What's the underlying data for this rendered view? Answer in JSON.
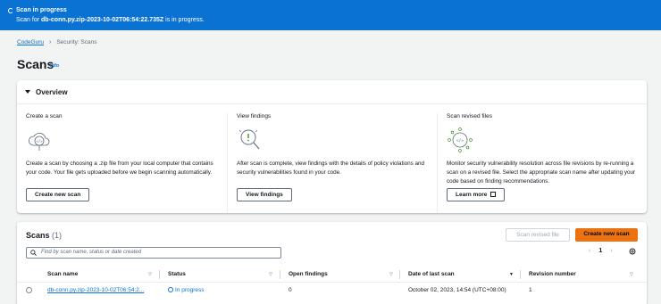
{
  "flash": {
    "title": "Scan in progress",
    "message_prefix": "Scan for ",
    "scan_name": "db-conn.py.zip-2023-10-02T06:54:22.735Z",
    "message_suffix": " is in progress."
  },
  "breadcrumb": {
    "root": "CodeGuru",
    "current": "Security: Scans"
  },
  "page": {
    "title": "Scans",
    "info": "Info"
  },
  "overview": {
    "title": "Overview",
    "columns": [
      {
        "title": "Create a scan",
        "icon": "upload-cloud-icon",
        "text": "Create a scan by choosing a .zip file from your local computer that contains your code. Your file gets uploaded before we begin scanning automatically.",
        "button": "Create new scan"
      },
      {
        "title": "View findings",
        "icon": "magnifier-alert-icon",
        "text": "After scan is complete, view findings with the details of policy violations and security vulnerabilities found in your code.",
        "button": "View findings"
      },
      {
        "title": "Scan revised files",
        "icon": "code-revision-icon",
        "text": "Monitor security vulnerability resolution across file revisions by re-running a scan on a revised file. Select the appropriate scan name after updating your code based on finding recommendations.",
        "button": "Learn more"
      }
    ]
  },
  "scans": {
    "title": "Scans",
    "count": "(1)",
    "scan_revised_label": "Scan revised file",
    "create_label": "Create new scan",
    "search_placeholder": "Find by scan name, status or date created",
    "page": "1",
    "columns": [
      "Scan name",
      "Status",
      "Open findings",
      "Date of last scan",
      "Revision number"
    ],
    "rows": [
      {
        "name": "db-conn.py.zip-2023-10-02T06:54:2...",
        "status": "In progress",
        "open_findings": "0",
        "date": "October 02, 2023, 14:54 (UTC+08:00)",
        "revision": "1"
      }
    ]
  },
  "colors": {
    "flash_bg": "#0972d3",
    "primary": "#ec7211",
    "link": "#0972d3"
  }
}
